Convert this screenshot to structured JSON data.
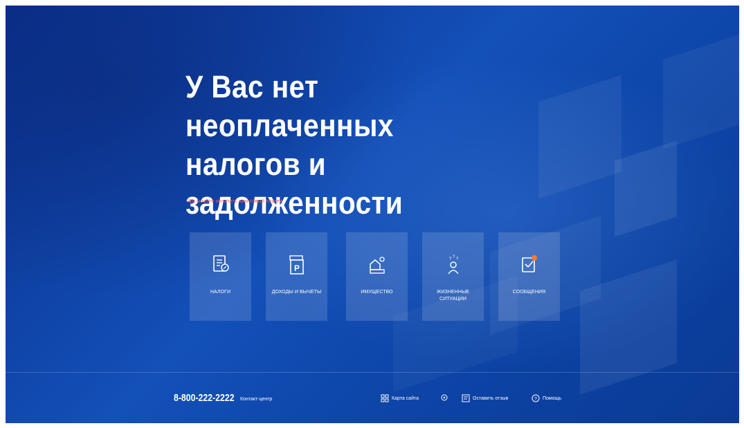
{
  "hero": {
    "title_line1": "У Вас нет неоплаченных",
    "title_line2": "налогов и задолженности",
    "hint": "Вы можете оплатить авансовый платеж"
  },
  "tiles": [
    {
      "label": "НАЛОГИ",
      "icon": "tax-document-icon"
    },
    {
      "label": "ДОХОДЫ И ВЫЧЕТЫ",
      "icon": "income-deductions-icon"
    },
    {
      "label": "ИМУЩЕСТВО",
      "icon": "property-icon"
    },
    {
      "label": "ЖИЗНЕННЫЕ СИТУАЦИИ",
      "icon": "life-situations-icon"
    },
    {
      "label": "СООБЩЕНИЯ",
      "icon": "messages-icon"
    }
  ],
  "footer": {
    "phone": "8-800-222-2222",
    "contact_label": "Контакт-центр",
    "links": [
      {
        "label": "Карта сайта",
        "icon": "sitemap-icon"
      },
      {
        "label": "",
        "icon": "accessibility-icon"
      },
      {
        "label": "Оставить отзыв",
        "icon": "feedback-icon"
      },
      {
        "label": "Помощь",
        "icon": "help-icon"
      }
    ]
  },
  "colors": {
    "background": "#1350b8",
    "hint_text": "#ff5a5a",
    "badge": "#ff7a2e"
  }
}
